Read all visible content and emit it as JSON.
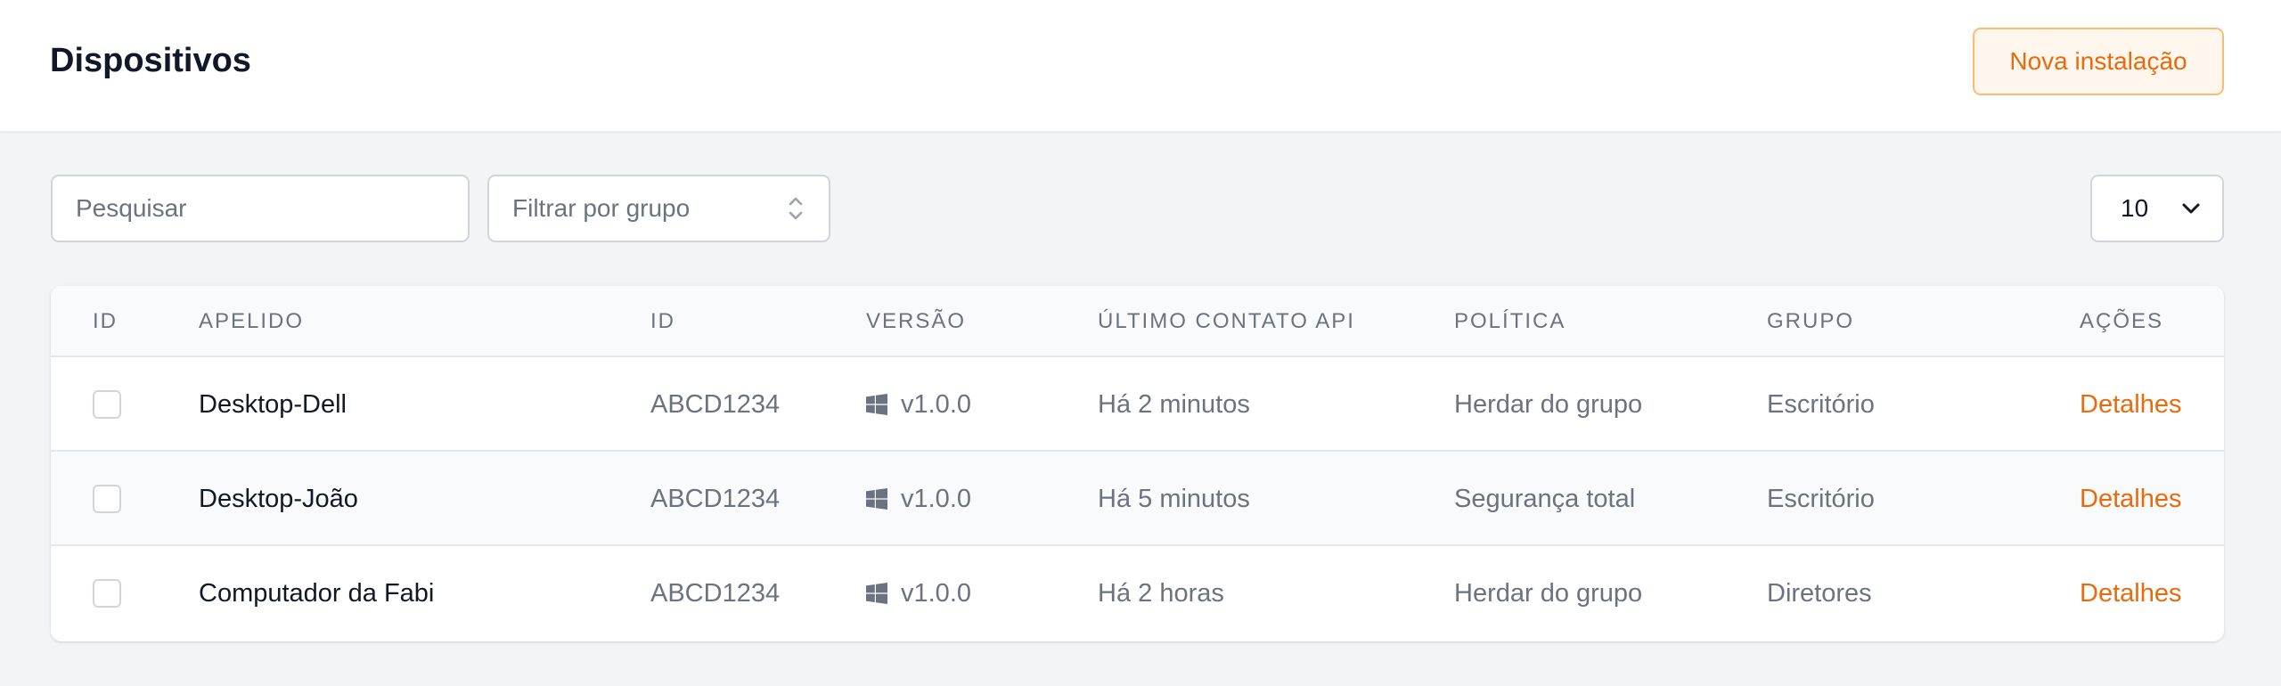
{
  "header": {
    "title": "Dispositivos",
    "new_install_label": "Nova instalação"
  },
  "filters": {
    "search_placeholder": "Pesquisar",
    "group_placeholder": "Filtrar por grupo",
    "group_icon": "chevron-up-down-icon",
    "page_size": "10",
    "page_size_icon": "chevron-down-icon"
  },
  "table": {
    "columns": [
      "ID",
      "Apelido",
      "ID",
      "Versão",
      "Último contato API",
      "Política",
      "Grupo",
      "Ações"
    ],
    "os_icon": "windows-icon",
    "rows": [
      {
        "nickname": "Desktop-Dell",
        "id": "ABCD1234",
        "version": "v1.0.0",
        "last_contact": "Há 2 minutos",
        "policy": "Herdar do grupo",
        "group": "Escritório",
        "action": "Detalhes"
      },
      {
        "nickname": "Desktop-João",
        "id": "ABCD1234",
        "version": "v1.0.0",
        "last_contact": "Há 5 minutos",
        "policy": "Segurança total",
        "group": "Escritório",
        "action": "Detalhes"
      },
      {
        "nickname": "Computador da Fabi",
        "id": "ABCD1234",
        "version": "v1.0.0",
        "last_contact": "Há 2 horas",
        "policy": "Herdar do grupo",
        "group": "Diretores",
        "action": "Detalhes"
      }
    ]
  },
  "colors": {
    "accent": "#ea6a0c",
    "accent_border": "#fdba74",
    "accent_bg": "#fff7ed",
    "page_bg": "#f3f4f6"
  }
}
